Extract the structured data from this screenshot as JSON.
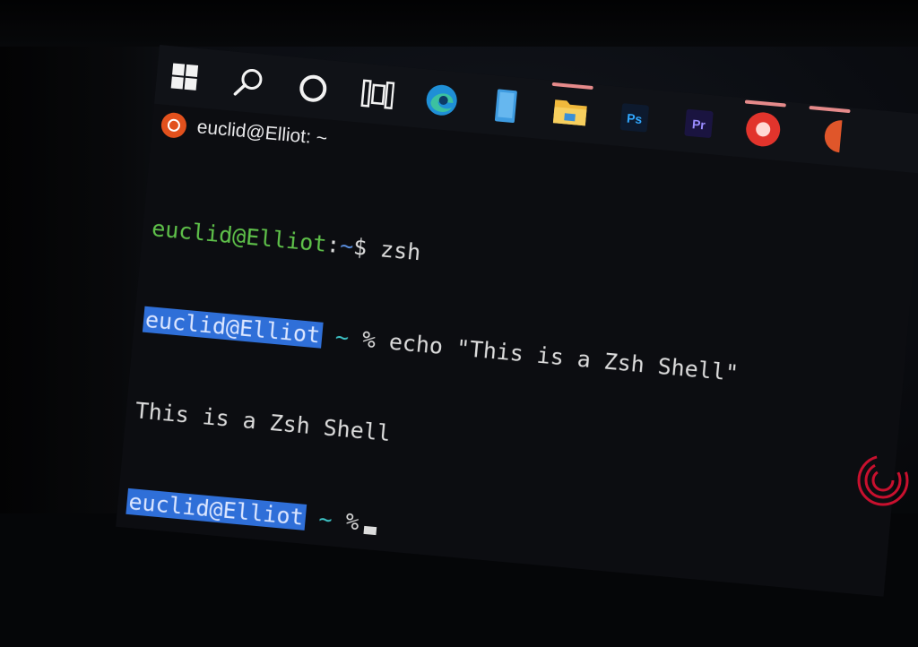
{
  "window": {
    "title": "euclid@Elliot: ~"
  },
  "taskbar": {
    "items": [
      {
        "icon": "windows-start-icon",
        "active": false
      },
      {
        "icon": "search-icon",
        "active": true
      },
      {
        "icon": "cortana-circle-icon",
        "active": false
      },
      {
        "icon": "task-view-icon",
        "active": false
      },
      {
        "icon": "edge-icon",
        "active": false
      },
      {
        "icon": "phone-icon",
        "active": false
      },
      {
        "icon": "file-explorer-icon",
        "active": true
      },
      {
        "icon": "photoshop-icon",
        "active": false
      },
      {
        "icon": "premiere-icon",
        "active": false
      },
      {
        "icon": "red-app-icon",
        "active": true
      },
      {
        "icon": "partial-app-icon",
        "active": true
      }
    ],
    "labels": {
      "ps": "Ps",
      "pr": "Pr"
    }
  },
  "terminal": {
    "line1": {
      "user": "euclid@Elliot",
      "colon": ":",
      "path": "~",
      "prompt": "$ ",
      "cmd": "zsh"
    },
    "line2": {
      "user": "euclid@Elliot",
      "tilde": "~",
      "prompt": "%",
      "cmd": " echo \"This is a Zsh Shell\""
    },
    "line3": {
      "output": "This is a Zsh Shell"
    },
    "line4": {
      "user": "euclid@Elliot",
      "tilde": "~",
      "prompt": "%"
    }
  },
  "colors": {
    "bash_user": "#5fc24a",
    "bash_path": "#5b8fe0",
    "zsh_highlight": "#2f6fd8",
    "tilde": "#3ec6c9",
    "ubuntu_orange": "#e2511d"
  },
  "watermark": {
    "icon": "brand-logo-icon"
  }
}
